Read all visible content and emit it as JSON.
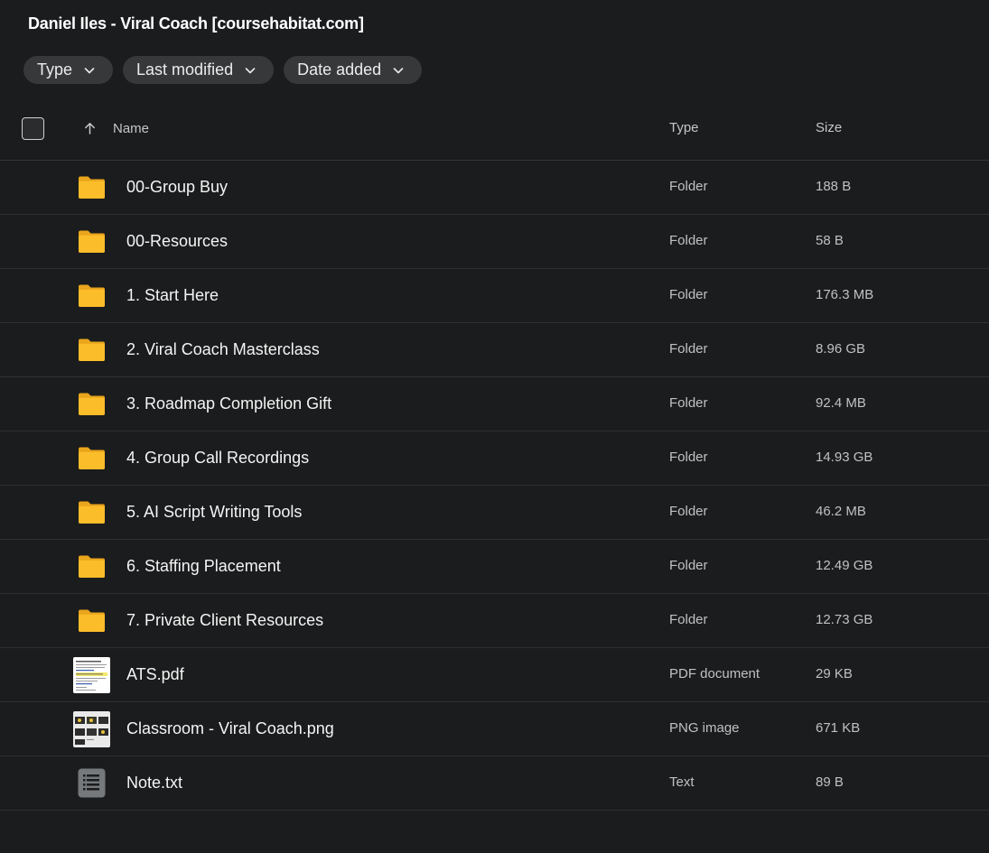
{
  "title": "Daniel Iles - Viral Coach [coursehabitat.com]",
  "filters": [
    {
      "label": "Type",
      "icon": "chevron-down-icon"
    },
    {
      "label": "Last modified",
      "icon": "chevron-down-icon"
    },
    {
      "label": "Date added",
      "icon": "chevron-down-icon"
    }
  ],
  "columns": {
    "name": "Name",
    "type": "Type",
    "size": "Size",
    "sort_icon": "arrow-up-icon"
  },
  "colors": {
    "background": "#1b1c1d",
    "folder": "#fcbd2a",
    "chip": "#36383a"
  },
  "files": [
    {
      "name": "00-Group Buy",
      "type": "Folder",
      "size": "188 B",
      "icon": "folder-icon"
    },
    {
      "name": "00-Resources",
      "type": "Folder",
      "size": "58 B",
      "icon": "folder-icon"
    },
    {
      "name": "1. Start Here",
      "type": "Folder",
      "size": "176.3 MB",
      "icon": "folder-icon"
    },
    {
      "name": "2. Viral Coach Masterclass",
      "type": "Folder",
      "size": "8.96 GB",
      "icon": "folder-icon"
    },
    {
      "name": "3. Roadmap Completion Gift",
      "type": "Folder",
      "size": "92.4 MB",
      "icon": "folder-icon"
    },
    {
      "name": "4. Group Call Recordings",
      "type": "Folder",
      "size": "14.93 GB",
      "icon": "folder-icon"
    },
    {
      "name": "5. AI Script Writing Tools",
      "type": "Folder",
      "size": "46.2 MB",
      "icon": "folder-icon"
    },
    {
      "name": "6. Staffing Placement",
      "type": "Folder",
      "size": "12.49 GB",
      "icon": "folder-icon"
    },
    {
      "name": "7. Private Client Resources",
      "type": "Folder",
      "size": "12.73 GB",
      "icon": "folder-icon"
    },
    {
      "name": "ATS.pdf",
      "type": "PDF document",
      "size": "29 KB",
      "icon": "pdf-thumbnail"
    },
    {
      "name": "Classroom - Viral Coach.png",
      "type": "PNG image",
      "size": "671 KB",
      "icon": "image-thumbnail"
    },
    {
      "name": "Note.txt",
      "type": "Text",
      "size": "89 B",
      "icon": "text-file-icon"
    }
  ]
}
